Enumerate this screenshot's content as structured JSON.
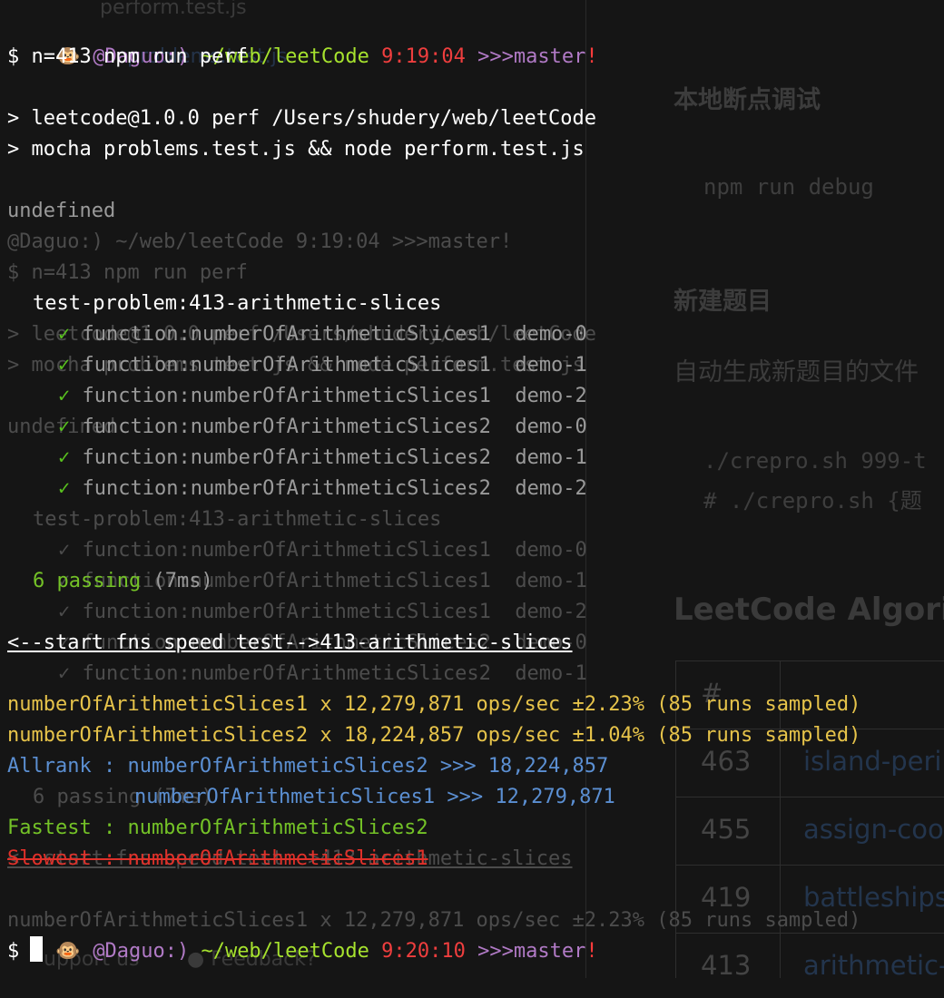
{
  "background_doc": {
    "heading_debug": "本地断点调试",
    "code_debug": "npm run debug",
    "heading_new": "新建题目",
    "paragraph_new": "自动生成新题目的文件",
    "code_crepro": "./crepro.sh 999-t",
    "code_crepro_comment": "# ./crepro.sh {题",
    "heading_algorithms": "LeetCode Algorit",
    "table_header_num": "#",
    "table_rows": [
      {
        "num": "463",
        "name": "island-peri"
      },
      {
        "num": "455",
        "name": "assign-coo"
      },
      {
        "num": "419",
        "name": "battleships"
      },
      {
        "num": "413",
        "name": "arithmetic-"
      }
    ],
    "footer_support": "upport us",
    "footer_feedback": "Feedback?",
    "ghost_file_perform": "perform.test.js",
    "ghost_file_problems": "problems.test.js"
  },
  "ghost_lines": [
    "test-problem:413-arithmetic-slices",
    "✓ function:numberOfArithmeticSlices1  demo-0",
    "✓ function:numberOfArithmeticSlices1  demo-1",
    "✓ function:numberOfArithmeticSlices1  demo-2",
    "✓ function:numberOfArithmeticSlices2  demo-0",
    "✓ function:numberOfArithmeticSlices2  demo-1",
    "6 passing (7ms)",
    "<--start fns speed test-->413-arithmetic-slices",
    "numberOfArithmeticSlices1 x 12,279,871 ops/sec ±2.23% (85 runs sampled)",
    "undefined",
    "@Daguo:) ~/web/leetCode 9:19:04 >>>master!",
    "$ n=413 npm run perf",
    "> leetcode@1.0.0 perf /Users/shudery/web/leetCode",
    "> mocha problems.test.js && node perform.test.js"
  ],
  "prompt1": {
    "user": "@Daguo:)",
    "path": "~/web/leetCode",
    "time": "9:19:04",
    "branch": ">>>master",
    "dirty": "!"
  },
  "command": "$ n=413 npm run perf",
  "npm_header_1": "> leetcode@1.0.0 perf /Users/shudery/web/leetCode",
  "npm_header_2": "> mocha problems.test.js && node perform.test.js",
  "undefined_text": "undefined",
  "test_suite": "test-problem:413-arithmetic-slices",
  "tests": [
    "function:numberOfArithmeticSlices1  demo-0",
    "function:numberOfArithmeticSlices1  demo-1",
    "function:numberOfArithmeticSlices1  demo-2",
    "function:numberOfArithmeticSlices2  demo-0",
    "function:numberOfArithmeticSlices2  demo-1",
    "function:numberOfArithmeticSlices2  demo-2"
  ],
  "check_mark": "✓",
  "passing_label": "6 passing",
  "passing_time": "(7ms)",
  "speed_header": "<--start fns speed test-->413-arithmetic-slices",
  "bench_1": "numberOfArithmeticSlices1 x 12,279,871 ops/sec ±2.23% (85 runs sampled)",
  "bench_2": "numberOfArithmeticSlices2 x 18,224,857 ops/sec ±1.04% (85 runs sampled)",
  "allrank_label": "Allrank : ",
  "allrank_1": "numberOfArithmeticSlices2 >>> 18,224,857",
  "allrank_2": "numberOfArithmeticSlices1 >>> 12,279,871",
  "fastest": "Fastest : numberOfArithmeticSlices2",
  "slowest": "Slowest : numberOfArithmeticSlices1",
  "prompt2": {
    "user": "@Daguo:)",
    "path": "~/web/leetCode",
    "time": "9:20:10",
    "branch": ">>>master",
    "dirty": "!"
  },
  "prompt_symbol": "$",
  "monkey_icon": "🐵",
  "colors": {
    "background": "#151515",
    "green": "#a6e22e",
    "check": "#59c21e",
    "purple": "#b17ac6",
    "red": "#ff3b3b",
    "yellow": "#e6c34a",
    "blue": "#5b8fd2"
  }
}
